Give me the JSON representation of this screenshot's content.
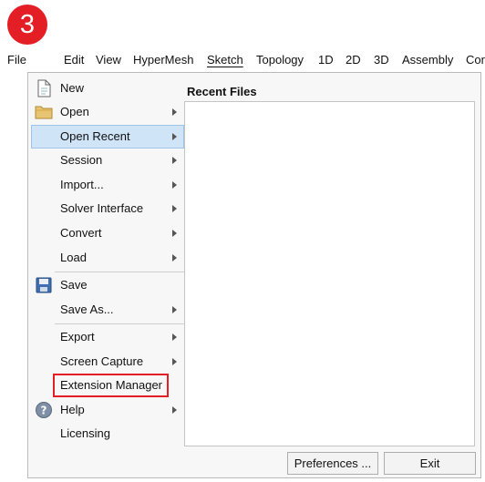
{
  "step_badge": "3",
  "menubar": {
    "items": [
      "File",
      "Edit",
      "View",
      "HyperMesh",
      "Sketch",
      "Topology",
      "1D",
      "2D",
      "3D",
      "Assembly",
      "Cor"
    ]
  },
  "file_menu": {
    "items": [
      {
        "label": "New",
        "icon": "new-document-icon",
        "submenu": false
      },
      {
        "label": "Open",
        "icon": "folder-icon",
        "submenu": true
      },
      {
        "label": "Open Recent",
        "submenu": true,
        "highlighted": true
      },
      {
        "label": "Session",
        "submenu": true
      },
      {
        "label": "Import...",
        "submenu": true
      },
      {
        "label": "Solver Interface",
        "submenu": true
      },
      {
        "label": "Convert",
        "submenu": true
      },
      {
        "label": "Load",
        "submenu": true
      },
      {
        "label": "Save",
        "icon": "floppy-disk-icon",
        "submenu": false
      },
      {
        "label": "Save As...",
        "submenu": true
      },
      {
        "label": "Export",
        "submenu": true
      },
      {
        "label": "Screen Capture",
        "submenu": true
      },
      {
        "label": "Extension Manager",
        "submenu": false,
        "outlined": true
      },
      {
        "label": "Help",
        "icon": "help-icon",
        "submenu": true
      },
      {
        "label": "Licensing",
        "submenu": false
      }
    ]
  },
  "recent_files": {
    "title": "Recent Files"
  },
  "buttons": {
    "preferences": "Preferences ...",
    "exit": "Exit"
  },
  "colors": {
    "badge": "#e41e25",
    "highlight": "#cfe4f7",
    "outline": "#e41e25"
  }
}
